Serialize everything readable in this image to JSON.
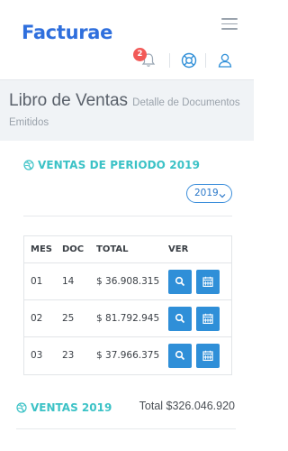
{
  "app": {
    "logo": "Facturae"
  },
  "header": {
    "notifications_count": "2",
    "icons": [
      "bell-icon",
      "lifebuoy-icon",
      "user-icon",
      "hamburger-menu-icon"
    ]
  },
  "page": {
    "title": "Libro de Ventas",
    "subtitle": "Detalle de Documentos Emitidos"
  },
  "period": {
    "heading": "VENTAS DE PERIODO 2019",
    "year_select": "2019"
  },
  "table": {
    "headers": [
      "MES",
      "DOC",
      "TOTAL",
      "VER"
    ],
    "rows": [
      {
        "mes": "01",
        "doc": "14",
        "total": "$ 36.908.315"
      },
      {
        "mes": "02",
        "doc": "25",
        "total": "$ 81.792.945"
      },
      {
        "mes": "03",
        "doc": "23",
        "total": "$ 37.966.375"
      }
    ]
  },
  "summary": {
    "heading": "VENTAS 2019",
    "total": "Total $326.046.920"
  },
  "colors": {
    "brand": "#2f6fdd",
    "accent": "#3bc2c6",
    "button": "#2f8fd8",
    "badge": "#f25a58"
  }
}
